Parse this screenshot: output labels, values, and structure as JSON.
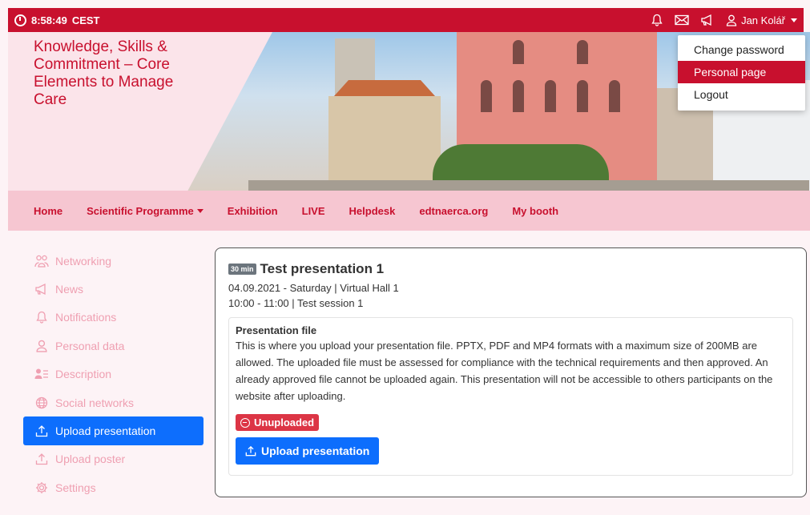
{
  "topbar": {
    "time": "8:58:49",
    "timezone": "CEST",
    "user_name": "Jan Kolář"
  },
  "user_menu": {
    "items": [
      {
        "label": "Change password",
        "active": false
      },
      {
        "label": "Personal page",
        "active": true
      },
      {
        "label": "Logout",
        "active": false
      }
    ]
  },
  "banner": {
    "title": "Knowledge, Skills & Commitment – Core Elements to Manage Care"
  },
  "nav": {
    "items": [
      "Home",
      "Scientific Programme",
      "Exhibition",
      "LIVE",
      "Helpdesk",
      "edtnaerca.org",
      "My booth"
    ]
  },
  "sidebar": {
    "items": [
      {
        "label": "Networking",
        "icon": "people-icon"
      },
      {
        "label": "News",
        "icon": "megaphone-icon"
      },
      {
        "label": "Notifications",
        "icon": "bell-icon"
      },
      {
        "label": "Personal data",
        "icon": "person-icon"
      },
      {
        "label": "Description",
        "icon": "person-lines-icon"
      },
      {
        "label": "Social networks",
        "icon": "globe-icon"
      },
      {
        "label": "Upload presentation",
        "icon": "upload-icon"
      },
      {
        "label": "Upload poster",
        "icon": "upload-icon"
      },
      {
        "label": "Settings",
        "icon": "gear-icon"
      }
    ]
  },
  "presentation": {
    "duration": "30 min",
    "title": "Test presentation 1",
    "date_line": "04.09.2021 - Saturday | Virtual Hall 1",
    "time_line": "10:00 - 11:00 | Test session 1",
    "file_section_title": "Presentation file",
    "file_section_desc": "This is where you upload your presentation file. PPTX, PDF and MP4 formats with a maximum size of 200MB are allowed. The uploaded file must be assessed for compliance with the technical requirements and then approved. An already approved file cannot be uploaded again. This presentation will not be accessible to others participants on the website after uploading.",
    "status": "Unuploaded",
    "upload_button": "Upload presentation"
  },
  "colors": {
    "brand_red": "#c8102e",
    "nav_pink": "#f6c6d1",
    "sidebar_text": "#ef9fb1",
    "primary_blue": "#0d6efd",
    "danger_red": "#dc3545"
  }
}
